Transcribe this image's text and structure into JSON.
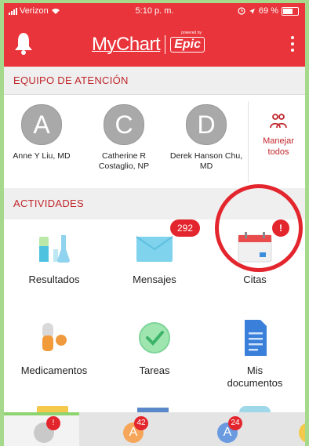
{
  "status_bar": {
    "carrier": "Verizon",
    "time": "5:10 p. m.",
    "battery": "69 %",
    "battery_level": 0.69
  },
  "header": {
    "logo_text": "MyChart",
    "powered_by": "powered by",
    "logo_brand": "Epic"
  },
  "care_team": {
    "section_title": "EQUIPO DE ATENCIÓN",
    "providers": [
      {
        "initial": "A",
        "name": "Anne Y Liu, MD"
      },
      {
        "initial": "C",
        "name": "Catherine R Costaglio, NP"
      },
      {
        "initial": "D",
        "name": "Derek Hanson Chu, MD"
      }
    ],
    "manage_label": "Manejar todos"
  },
  "activities": {
    "section_title": "ACTIVIDADES",
    "items": [
      {
        "label": "Resultados",
        "icon": "test-tubes-icon"
      },
      {
        "label": "Mensajes",
        "icon": "envelope-icon",
        "badge": "292"
      },
      {
        "label": "Citas",
        "icon": "calendar-icon",
        "badge": "!"
      },
      {
        "label": "Medicamentos",
        "icon": "pills-icon"
      },
      {
        "label": "Tareas",
        "icon": "checkmark-icon"
      },
      {
        "label": "Mis documentos",
        "icon": "document-icon"
      }
    ]
  },
  "tab_bar": {
    "tabs": [
      {
        "initial": "",
        "badge": "!",
        "color": "#c9c9c9"
      },
      {
        "initial": "A",
        "badge": "42",
        "color": "#f5a65b"
      },
      {
        "initial": "A",
        "badge": "24",
        "color": "#6a9be0"
      },
      {
        "initial": "",
        "badge": "",
        "color": "#f4c84b"
      }
    ]
  },
  "colors": {
    "brand_red": "#e8343a",
    "section_text": "#c0262b",
    "badge_red": "#e3262d",
    "highlight_ring": "#e3262d"
  }
}
